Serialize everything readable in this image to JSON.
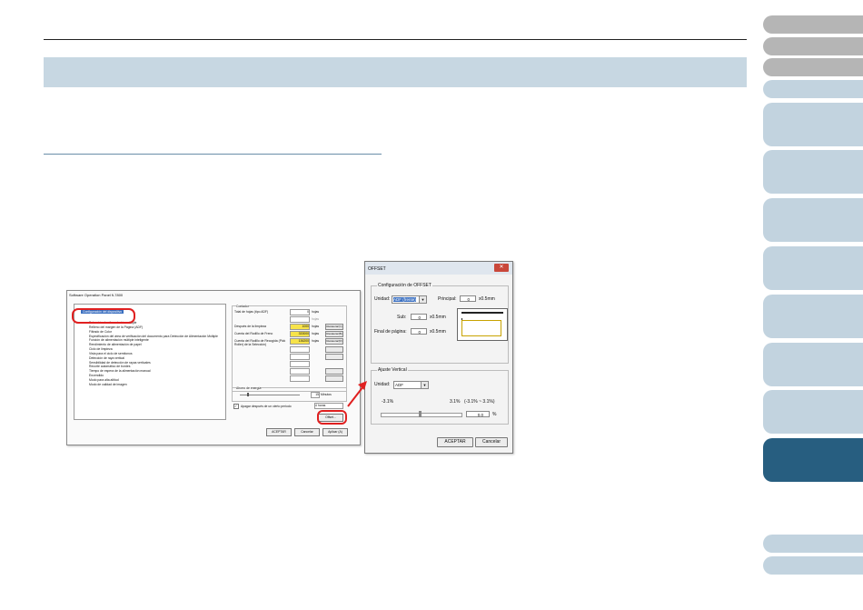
{
  "sidetabs": [
    "",
    "",
    "",
    "",
    "",
    "",
    "",
    "",
    "",
    "",
    "",
    "",
    ""
  ],
  "screenshot1": {
    "title": "Software Operation Panel fi-7800",
    "tree_selected": "Configuración del dispositivo",
    "tree_items": [
      "Detección de alimentación múltiple",
      "Relleno del margen de la Página (ADF)",
      "Filtrado de Color",
      "Especificación del área de verificación del documento para Detección de Alimentación Múltiple",
      "Función de alimentación múltiple inteligente",
      "Rendimiento de alimentación de papel",
      "Ciclo de limpieza",
      "Vista para el ciclo de semitonos",
      "Detección de raya vertical",
      "Sensibilidad de detección de rayas verticales",
      "Recorte automático de bordes",
      "Tiempo de espera de la alimentación manual",
      "Encendido",
      "Modo para alta altitud",
      "Modo de calidad de imagen"
    ],
    "counters_label": "Contador",
    "counter_rows": [
      {
        "label": "Total de hojas (tipo ADF)",
        "value": "0",
        "unit": "hojas"
      },
      {
        "label": "",
        "value": "",
        "unit": "hojas"
      },
      {
        "label": "Después de la limpieza",
        "value": "1000",
        "unit": "hojas",
        "button": "Restaurar(C)"
      },
      {
        "label": "Cuenta del Rodillo de Freno",
        "value": "333000",
        "unit": "hojas",
        "button": "Restaurar(B)"
      },
      {
        "label": "Cuenta del Rodillo de Recogida (Pick Roller) de la Selección)",
        "value": "136200",
        "unit": "hojas",
        "button": "Restaurar(R)"
      }
    ],
    "energy_label": "Ahorro de energía",
    "energy_minutes": "15",
    "energy_minutes_unit": "Minutos",
    "power_off_label": "Apagar después de un cierto periodo",
    "power_off_value": "4 horas",
    "offset_button": "Offset...",
    "ok_button": "ACEPTAR",
    "cancel_button": "Cancelar",
    "apply_button": "Aplicar (A)"
  },
  "screenshot2": {
    "title": "OFFSET",
    "offset_group": "Configuración de OFFSET",
    "unit_label": "Unidad:",
    "unit_value": "ADF (frente)",
    "principal_label": "Principal:",
    "principal_value": "0",
    "step_unit": "x0.5mm",
    "sub_label": "Sub:",
    "sub_value": "0",
    "end_label": "Final de página:",
    "end_value": "0",
    "vertical_group": "Ajuste Vertical",
    "vunit_label": "Unidad:",
    "vunit_value": "ADF",
    "range_left": "-3.1%",
    "range_right": "3.1%",
    "range_note": "(-3.1% ~ 3.1%)",
    "vertical_value": "0.0",
    "percent": "%",
    "ok_button": "ACEPTAR",
    "cancel_button": "Cancelar"
  },
  "colors": {
    "accent": "#e02020",
    "banner": "#c7d7e2",
    "active_tab": "#275e80"
  }
}
